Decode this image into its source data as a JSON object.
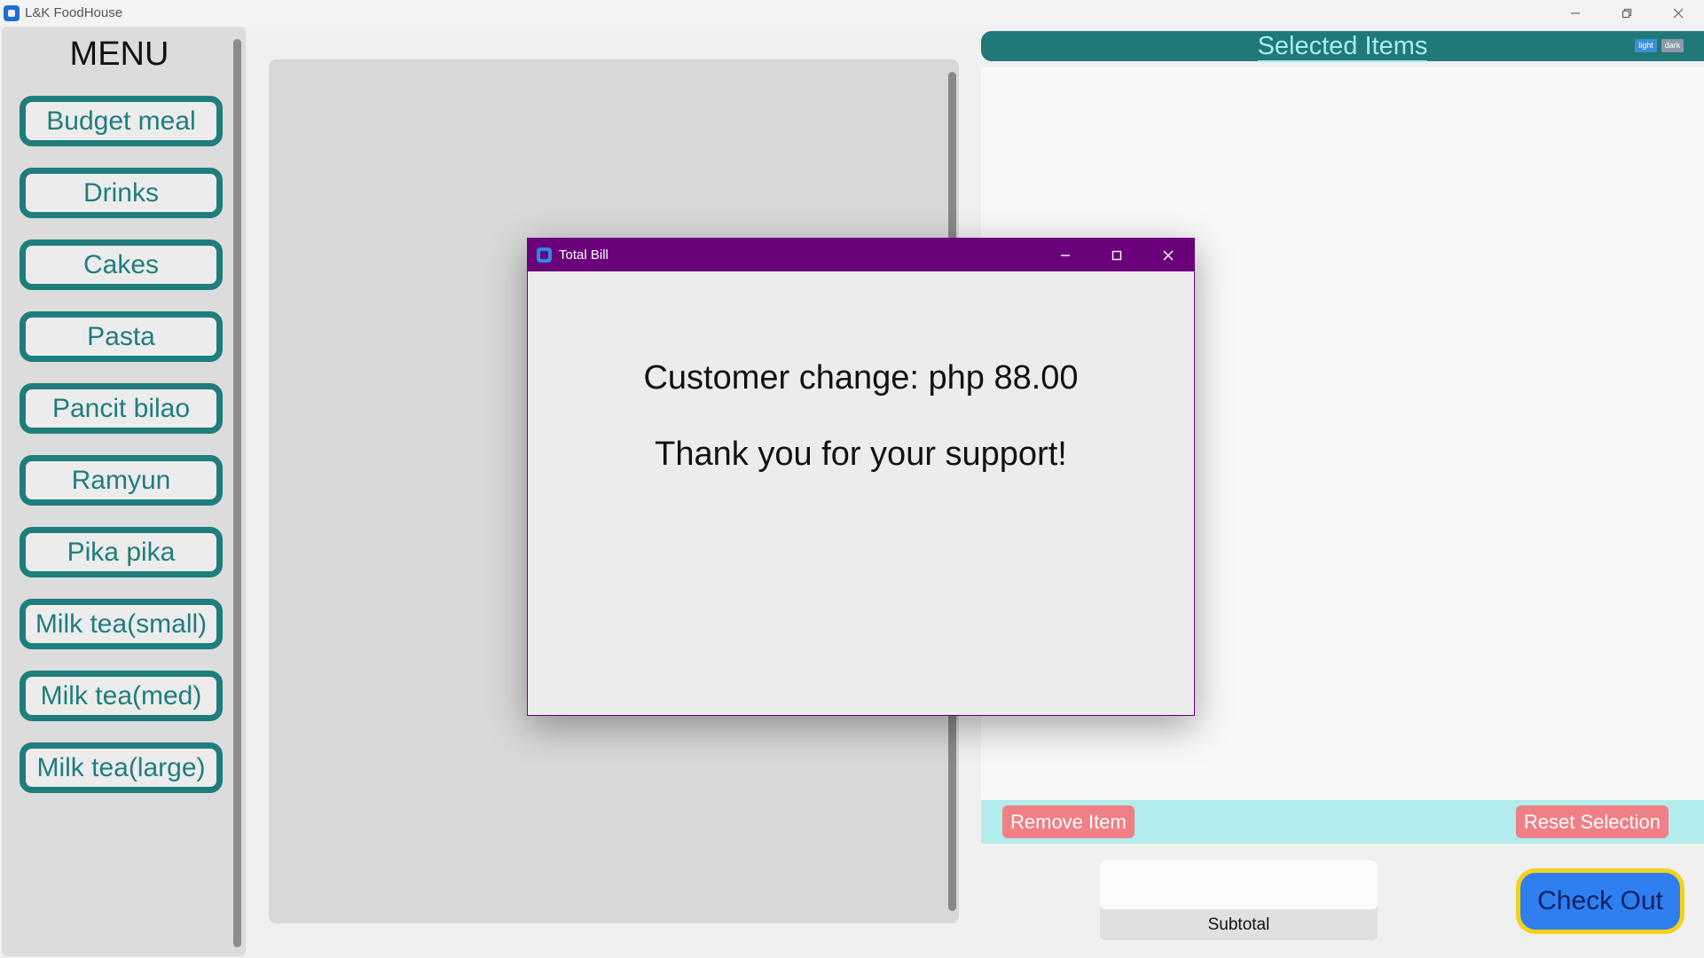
{
  "window": {
    "title": "L&K FoodHouse",
    "controls": [
      "minimize-icon",
      "restore-icon",
      "close-icon"
    ]
  },
  "menu": {
    "title": "MENU",
    "items": [
      {
        "label": "Budget meal"
      },
      {
        "label": "Drinks"
      },
      {
        "label": "Cakes"
      },
      {
        "label": "Pasta"
      },
      {
        "label": "Pancit bilao"
      },
      {
        "label": "Ramyun"
      },
      {
        "label": "Pika pika"
      },
      {
        "label": "Milk tea(small)"
      },
      {
        "label": "Milk tea(med)"
      },
      {
        "label": "Milk tea(large)"
      }
    ]
  },
  "selected": {
    "title": "Selected Items",
    "theme_light": "light",
    "theme_dark": "dark"
  },
  "actions": {
    "remove_label": "Remove Item",
    "reset_label": "Reset Selection"
  },
  "subtotal": {
    "value": "",
    "label": "Subtotal"
  },
  "checkout": {
    "label": "Check Out"
  },
  "dialog": {
    "title": "Total Bill",
    "change_message": "Customer change: php 88.00",
    "thanks_message": "Thank you for your support!"
  },
  "colors": {
    "teal": "#207d7d",
    "dialog_title_bar": "#6b007b",
    "action_bar": "#b2ecec",
    "action_button": "#f07f86",
    "checkout_fill": "#2f7ff0",
    "checkout_border": "#f5d216"
  }
}
